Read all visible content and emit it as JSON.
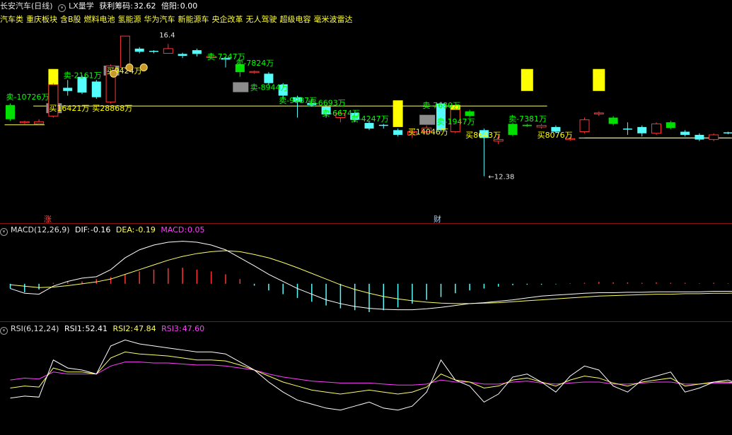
{
  "header": {
    "stock_name": "长安汽车",
    "period": "(日线)",
    "indicator_name": "LX量学",
    "profit_label": "获利筹码:",
    "profit_value": "32.62",
    "ratio_label": "倍阳:",
    "ratio_value": "0.00",
    "sectors": [
      "汽车类",
      "重庆板块",
      "含B股",
      "燃料电池",
      "氢能源",
      "华为汽车",
      "新能源车",
      "央企改革",
      "无人驾驶",
      "超级电容",
      "毫米波雷达"
    ]
  },
  "markers": {
    "zhang": "涨",
    "cai": "财"
  },
  "macd": {
    "label": "MACD(12,26,9)",
    "dif_label": "DIF:",
    "dif": "-0.16",
    "dea_label": "DEA:",
    "dea": "-0.19",
    "macd_label": "MACD:",
    "macd": "0.05"
  },
  "rsi": {
    "label": "RSI(6,12,24)",
    "rsi1_label": "RSI1:",
    "rsi1": "52.41",
    "rsi2_label": "RSI2:",
    "rsi2": "47.84",
    "rsi3_label": "RSI3:",
    "rsi3": "47.60"
  },
  "price_labels": {
    "high": "16.4",
    "low": "12.38"
  },
  "colors": {
    "up": "#ff3333",
    "down": "#54fcfc",
    "yellow": "#ffff00",
    "sell_text": "#00ff00",
    "buy_text": "#ffff00",
    "magenta": "#ff40ff",
    "dif": "#ffffff",
    "dea": "#ffff66"
  },
  "chart_data": {
    "type": "candlestick",
    "candles": [
      [
        14.2,
        14.65,
        14.15,
        14.7,
        "green"
      ],
      [
        14.1,
        14.12,
        14.05,
        14.15,
        "red"
      ],
      [
        14.05,
        14.12,
        14.0,
        14.2,
        "red"
      ],
      [
        14.3,
        15.3,
        14.25,
        15.35,
        "red"
      ],
      [
        15.2,
        15.1,
        14.95,
        15.45,
        "cyan"
      ],
      [
        15.05,
        15.55,
        15.0,
        15.6,
        "cyan"
      ],
      [
        15.4,
        14.9,
        14.85,
        15.45,
        "cyan"
      ],
      [
        14.75,
        15.9,
        14.7,
        15.95,
        "red"
      ],
      [
        15.85,
        16.85,
        15.8,
        16.85,
        "red"
      ],
      [
        16.45,
        16.35,
        16.3,
        16.5,
        "cyan"
      ],
      [
        16.35,
        16.38,
        16.3,
        16.4,
        "cyan"
      ],
      [
        16.3,
        16.45,
        16.3,
        16.6,
        "red"
      ],
      [
        16.28,
        16.22,
        16.15,
        16.32,
        "cyan"
      ],
      [
        16.4,
        16.28,
        16.2,
        16.45,
        "cyan"
      ],
      [
        16.18,
        16.2,
        16.15,
        16.3,
        "red"
      ],
      [
        16.15,
        16.1,
        15.85,
        16.2,
        "cyan"
      ],
      [
        15.95,
        15.7,
        15.55,
        16.0,
        "green"
      ],
      [
        15.7,
        15.72,
        15.65,
        15.75,
        "red"
      ],
      [
        15.65,
        15.35,
        15.3,
        15.7,
        "cyan"
      ],
      [
        15.3,
        14.95,
        14.85,
        15.35,
        "cyan"
      ],
      [
        14.9,
        14.75,
        14.25,
        14.95,
        "cyan"
      ],
      [
        14.72,
        14.65,
        14.6,
        14.75,
        "cyan"
      ],
      [
        14.6,
        14.35,
        14.25,
        14.65,
        "cyan"
      ],
      [
        14.25,
        14.38,
        14.1,
        14.5,
        "red"
      ],
      [
        14.4,
        14.18,
        14.1,
        14.45,
        "cyan"
      ],
      [
        14.08,
        13.9,
        13.85,
        14.12,
        "cyan"
      ],
      [
        14.0,
        14.02,
        13.9,
        14.05,
        "cyan"
      ],
      [
        13.85,
        13.7,
        13.65,
        13.9,
        "cyan"
      ],
      [
        13.7,
        13.8,
        13.6,
        13.9,
        "red"
      ],
      [
        13.8,
        13.92,
        13.7,
        14.0,
        "red"
      ],
      [
        14.7,
        13.85,
        13.8,
        14.75,
        "cyan"
      ],
      [
        14.5,
        13.8,
        13.75,
        14.55,
        "red"
      ],
      [
        14.45,
        14.3,
        14.25,
        14.5,
        "green"
      ],
      [
        13.85,
        13.6,
        12.38,
        13.9,
        "cyan"
      ],
      [
        13.5,
        13.55,
        13.4,
        13.7,
        "red"
      ],
      [
        13.7,
        14.05,
        13.65,
        14.1,
        "green"
      ],
      [
        13.98,
        14.02,
        13.95,
        14.05,
        "green"
      ],
      [
        13.95,
        14.0,
        13.9,
        14.05,
        "red"
      ],
      [
        13.95,
        13.8,
        13.75,
        14.0,
        "cyan"
      ],
      [
        13.55,
        13.58,
        13.52,
        13.62,
        "red"
      ],
      [
        13.8,
        14.18,
        13.75,
        14.25,
        "red"
      ],
      [
        14.38,
        14.4,
        14.3,
        14.45,
        "red"
      ],
      [
        14.25,
        14.05,
        14.0,
        14.3,
        "green"
      ],
      [
        13.88,
        13.9,
        13.7,
        14.1,
        "cyan"
      ],
      [
        13.95,
        13.75,
        13.65,
        14.0,
        "cyan"
      ],
      [
        13.75,
        14.05,
        13.7,
        14.1,
        "red"
      ],
      [
        14.1,
        13.92,
        13.88,
        14.15,
        "green"
      ],
      [
        13.8,
        13.7,
        13.65,
        13.85,
        "cyan"
      ],
      [
        13.7,
        13.55,
        13.5,
        13.75,
        "cyan"
      ],
      [
        13.55,
        13.7,
        13.5,
        13.75,
        "red"
      ],
      [
        13.75,
        13.78,
        13.72,
        13.8,
        "cyan"
      ],
      [
        13.65,
        13.75,
        13.62,
        13.78,
        "red"
      ],
      [
        13.8,
        13.72,
        13.7,
        14.0,
        "yellow"
      ]
    ],
    "price_range": [
      12.1,
      17.1
    ],
    "horizontal_lines": [
      {
        "price": 14.62,
        "from": 2,
        "to": 37,
        "color": "#ffff66"
      },
      {
        "price": 14.02,
        "from": 0,
        "to": 2,
        "color": "#ffff66"
      },
      {
        "price": 13.6,
        "from": 40,
        "to": 52,
        "color": "#ffff66"
      }
    ],
    "yellow_bars": [
      {
        "index": 3,
        "from": 14.62,
        "to": 15.8,
        "fill": "#ffff00"
      },
      {
        "index": 3,
        "from": 14.62,
        "to": 15.3,
        "fill": "#ff9ab0"
      },
      {
        "index": 36,
        "from": 15.1,
        "to": 15.8,
        "fill": "#ffff00"
      },
      {
        "index": 41,
        "from": 15.1,
        "to": 15.8,
        "fill": "#ffff00"
      },
      {
        "index": 27,
        "from": 13.95,
        "to": 14.8,
        "fill": "#ffff00"
      },
      {
        "index": 31,
        "from": 14.0,
        "to": 14.65,
        "fill": "#ffff00"
      }
    ],
    "gray_boxes": [
      {
        "index": 3,
        "price": 14.55
      },
      {
        "index": 7,
        "price": 15.75
      },
      {
        "index": 16,
        "price": 15.22
      },
      {
        "index": 29,
        "price": 14.18
      }
    ],
    "annotations": [
      {
        "text": "卖-10726万",
        "index": 0,
        "price": 14.92,
        "kind": "sell"
      },
      {
        "text": "卖-2161万",
        "index": 4,
        "price": 15.6,
        "kind": "sell"
      },
      {
        "text": "买16421万",
        "index": 3,
        "price": 14.55,
        "kind": "buy"
      },
      {
        "text": "买28868万",
        "index": 6,
        "price": 14.55,
        "kind": "buy"
      },
      {
        "text": "买9424万",
        "index": 7,
        "price": 15.75,
        "kind": "buy"
      },
      {
        "text": "卖-7247万",
        "index": 14,
        "price": 16.2,
        "kind": "sell"
      },
      {
        "text": "卖-7824万",
        "index": 16,
        "price": 16.0,
        "kind": "sell"
      },
      {
        "text": "卖-8944万",
        "index": 17,
        "price": 15.22,
        "kind": "sell"
      },
      {
        "text": "卖-9987万",
        "index": 19,
        "price": 14.8,
        "kind": "sell"
      },
      {
        "text": "卖-6693万",
        "index": 21,
        "price": 14.72,
        "kind": "sell"
      },
      {
        "text": "卖-6674万",
        "index": 22,
        "price": 14.4,
        "kind": "sell"
      },
      {
        "text": "卖-4247万",
        "index": 24,
        "price": 14.22,
        "kind": "sell"
      },
      {
        "text": "卖-7680万",
        "index": 29,
        "price": 14.65,
        "kind": "sell"
      },
      {
        "text": "卖-1947万",
        "index": 30,
        "price": 14.13,
        "kind": "sell"
      },
      {
        "text": "买14046万",
        "index": 28,
        "price": 13.8,
        "kind": "buy"
      },
      {
        "text": "买8643万",
        "index": 32,
        "price": 13.7,
        "kind": "buy"
      },
      {
        "text": "卖-7381万",
        "index": 35,
        "price": 14.22,
        "kind": "sell"
      },
      {
        "text": "买8076万",
        "index": 37,
        "price": 13.7,
        "kind": "buy"
      }
    ],
    "macd_histogram": [
      -0.1,
      -0.18,
      -0.12,
      0.02,
      0.06,
      0.05,
      0.1,
      0.14,
      0.2,
      0.26,
      0.3,
      0.33,
      0.34,
      0.3,
      0.26,
      0.2,
      0.1,
      -0.04,
      -0.14,
      -0.22,
      -0.3,
      -0.38,
      -0.46,
      -0.52,
      -0.56,
      -0.6,
      -0.56,
      -0.5,
      -0.42,
      -0.34,
      -0.28,
      -0.2,
      -0.14,
      -0.1,
      -0.06,
      -0.03,
      -0.02,
      -0.02,
      -0.01,
      0.01,
      0.02,
      0.04,
      0.03,
      0.03,
      0.02,
      0.03,
      0.02,
      0.02,
      0.01,
      0.02,
      0.01,
      0.01,
      0.05
    ],
    "macd_dif": [
      -0.1,
      -0.2,
      -0.22,
      -0.05,
      0.05,
      0.12,
      0.15,
      0.3,
      0.55,
      0.72,
      0.82,
      0.88,
      0.9,
      0.88,
      0.82,
      0.72,
      0.55,
      0.38,
      0.2,
      0.05,
      -0.1,
      -0.22,
      -0.34,
      -0.42,
      -0.48,
      -0.52,
      -0.54,
      -0.55,
      -0.55,
      -0.53,
      -0.5,
      -0.46,
      -0.42,
      -0.4,
      -0.37,
      -0.34,
      -0.3,
      -0.26,
      -0.24,
      -0.22,
      -0.2,
      -0.19,
      -0.19,
      -0.18,
      -0.18,
      -0.17,
      -0.17,
      -0.17,
      -0.17,
      -0.16,
      -0.16,
      -0.16,
      -0.16
    ],
    "macd_dea": [
      -0.02,
      -0.05,
      -0.08,
      -0.07,
      -0.04,
      0.0,
      0.04,
      0.1,
      0.2,
      0.3,
      0.4,
      0.5,
      0.58,
      0.64,
      0.68,
      0.7,
      0.68,
      0.62,
      0.55,
      0.45,
      0.34,
      0.22,
      0.1,
      -0.02,
      -0.12,
      -0.2,
      -0.27,
      -0.32,
      -0.36,
      -0.39,
      -0.41,
      -0.42,
      -0.42,
      -0.41,
      -0.4,
      -0.38,
      -0.36,
      -0.34,
      -0.32,
      -0.3,
      -0.28,
      -0.26,
      -0.25,
      -0.24,
      -0.23,
      -0.22,
      -0.22,
      -0.21,
      -0.21,
      -0.2,
      -0.2,
      -0.19,
      -0.19
    ],
    "macd_range": [
      -0.75,
      1.0
    ],
    "rsi1": [
      34,
      36,
      35,
      72,
      64,
      62,
      58,
      86,
      92,
      88,
      86,
      84,
      82,
      80,
      80,
      78,
      70,
      62,
      50,
      40,
      32,
      28,
      24,
      22,
      26,
      30,
      24,
      22,
      26,
      40,
      72,
      52,
      46,
      30,
      38,
      55,
      58,
      50,
      40,
      56,
      66,
      62,
      46,
      40,
      52,
      56,
      60,
      40,
      44,
      50,
      52,
      46,
      56
    ],
    "rsi2": [
      44,
      46,
      45,
      64,
      60,
      60,
      58,
      74,
      80,
      78,
      77,
      76,
      74,
      72,
      72,
      71,
      67,
      62,
      56,
      50,
      46,
      42,
      40,
      38,
      40,
      42,
      40,
      38,
      40,
      45,
      58,
      52,
      50,
      44,
      46,
      52,
      54,
      50,
      46,
      52,
      56,
      54,
      49,
      46,
      50,
      52,
      54,
      46,
      48,
      50,
      50,
      48,
      52
    ],
    "rsi3": [
      52,
      54,
      53,
      60,
      58,
      58,
      58,
      66,
      70,
      70,
      69,
      69,
      68,
      67,
      67,
      66,
      64,
      62,
      58,
      55,
      53,
      51,
      50,
      49,
      49,
      49,
      48,
      47,
      47,
      48,
      52,
      50,
      50,
      48,
      48,
      50,
      51,
      49,
      48,
      49,
      50,
      50,
      48,
      48,
      49,
      50,
      50,
      48,
      48,
      49,
      49,
      48,
      48
    ],
    "rsi_range": [
      0,
      100
    ]
  }
}
